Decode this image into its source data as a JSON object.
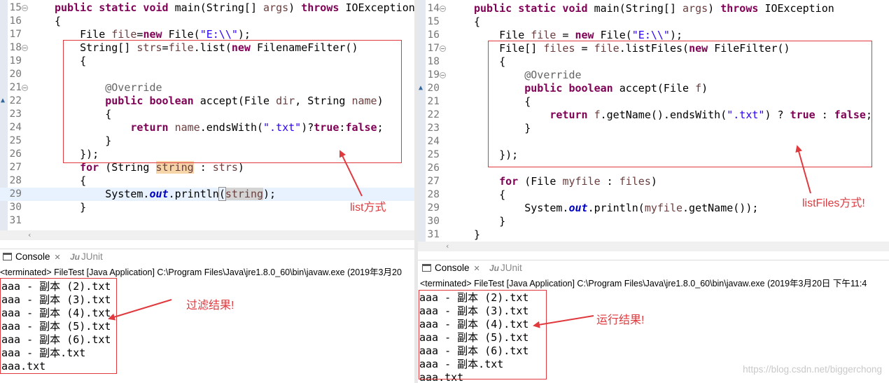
{
  "left": {
    "code": [
      {
        "n": "15",
        "fold": true,
        "t": [
          [
            "kw",
            "public static void "
          ],
          [
            "",
            "main(String[] "
          ],
          [
            "vr",
            "args"
          ],
          [
            "",
            ") "
          ],
          [
            "kw",
            "throws "
          ],
          [
            "",
            "IOException"
          ]
        ]
      },
      {
        "n": "16",
        "t": [
          [
            "",
            "{"
          ]
        ]
      },
      {
        "n": "17",
        "t": [
          [
            "",
            "    File "
          ],
          [
            "vr",
            "file"
          ],
          [
            "",
            "="
          ],
          [
            "kw",
            "new "
          ],
          [
            "",
            "File("
          ],
          [
            "st",
            "\"E:\\\\\""
          ],
          [
            "",
            ");"
          ]
        ]
      },
      {
        "n": "18",
        "fold": true,
        "t": [
          [
            "",
            "    String[] "
          ],
          [
            "vr",
            "strs"
          ],
          [
            "",
            "="
          ],
          [
            "vr",
            "file"
          ],
          [
            "",
            ".list("
          ],
          [
            "kw",
            "new "
          ],
          [
            "",
            "FilenameFilter()"
          ]
        ]
      },
      {
        "n": "19",
        "t": [
          [
            "",
            "    {"
          ]
        ]
      },
      {
        "n": "20",
        "t": []
      },
      {
        "n": "21",
        "fold": true,
        "t": [
          [
            "an",
            "        @Override"
          ]
        ]
      },
      {
        "n": "22",
        "ovr": true,
        "t": [
          [
            "kw",
            "        public boolean "
          ],
          [
            "",
            "accept(File "
          ],
          [
            "vr",
            "dir"
          ],
          [
            "",
            ", String "
          ],
          [
            "vr",
            "name"
          ],
          [
            "",
            ")"
          ]
        ]
      },
      {
        "n": "23",
        "t": [
          [
            "",
            "        {"
          ]
        ]
      },
      {
        "n": "24",
        "t": [
          [
            "kw",
            "            return "
          ],
          [
            "vr",
            "name"
          ],
          [
            "",
            ".endsWith("
          ],
          [
            "st",
            "\".txt\""
          ],
          [
            "",
            ")?"
          ],
          [
            "kw",
            "true"
          ],
          [
            "",
            ":"
          ],
          [
            "kw",
            "false"
          ],
          [
            "",
            ";"
          ]
        ]
      },
      {
        "n": "25",
        "t": [
          [
            "",
            "        }"
          ]
        ]
      },
      {
        "n": "26",
        "t": [
          [
            "",
            "    });"
          ]
        ]
      },
      {
        "n": "27",
        "t": [
          [
            "kw",
            "    for "
          ],
          [
            "",
            "(String "
          ],
          [
            "vr hl",
            "string"
          ],
          [
            "",
            " : "
          ],
          [
            "vr",
            "strs"
          ],
          [
            "",
            ")"
          ]
        ]
      },
      {
        "n": "28",
        "t": [
          [
            "",
            "    {"
          ]
        ]
      },
      {
        "n": "29",
        "cur": true,
        "t": [
          [
            "",
            "        System."
          ],
          [
            "fi",
            "out"
          ],
          [
            "",
            ".println"
          ],
          [
            "hl3",
            "("
          ],
          [
            "vr hl2",
            "string"
          ],
          [
            "",
            ");"
          ]
        ]
      },
      {
        "n": "30",
        "t": [
          [
            "",
            "    }"
          ]
        ]
      },
      {
        "n": "31",
        "t": []
      }
    ],
    "console_tab": "Console",
    "junit_tab": "JUnit",
    "terminated": "<terminated> FileTest [Java Application] C:\\Program Files\\Java\\jre1.8.0_60\\bin\\javaw.exe (2019年3月20",
    "output": [
      "aaa - 副本 (2).txt",
      "aaa - 副本 (3).txt",
      "aaa - 副本 (4).txt",
      "aaa - 副本 (5).txt",
      "aaa - 副本 (6).txt",
      "aaa - 副本.txt",
      "aaa.txt"
    ],
    "note_code": "list方式",
    "note_output": "过滤结果!"
  },
  "right": {
    "code": [
      {
        "n": "14",
        "fold": true,
        "t": [
          [
            "kw",
            "public static void "
          ],
          [
            "",
            "main(String[] "
          ],
          [
            "vr",
            "args"
          ],
          [
            "",
            ") "
          ],
          [
            "kw",
            "throws "
          ],
          [
            "",
            "IOException"
          ]
        ]
      },
      {
        "n": "15",
        "t": [
          [
            "",
            "{"
          ]
        ]
      },
      {
        "n": "16",
        "t": [
          [
            "",
            "    File "
          ],
          [
            "vr",
            "file"
          ],
          [
            "",
            " = "
          ],
          [
            "kw",
            "new "
          ],
          [
            "",
            "File("
          ],
          [
            "st",
            "\"E:\\\\\""
          ],
          [
            "",
            ");"
          ]
        ]
      },
      {
        "n": "17",
        "fold": true,
        "t": [
          [
            "",
            "    File[] "
          ],
          [
            "vr",
            "files"
          ],
          [
            "",
            " = "
          ],
          [
            "vr",
            "file"
          ],
          [
            "",
            ".listFiles("
          ],
          [
            "kw",
            "new "
          ],
          [
            "",
            "FileFilter()"
          ]
        ]
      },
      {
        "n": "18",
        "t": [
          [
            "",
            "    {"
          ]
        ]
      },
      {
        "n": "19",
        "fold": true,
        "t": [
          [
            "an",
            "        @Override"
          ]
        ]
      },
      {
        "n": "20",
        "ovr": true,
        "t": [
          [
            "kw",
            "        public boolean "
          ],
          [
            "",
            "accept(File "
          ],
          [
            "vr",
            "f"
          ],
          [
            "",
            ")"
          ]
        ]
      },
      {
        "n": "21",
        "t": [
          [
            "",
            "        {"
          ]
        ]
      },
      {
        "n": "22",
        "t": [
          [
            "kw",
            "            return "
          ],
          [
            "vr",
            "f"
          ],
          [
            "",
            ".getName().endsWith("
          ],
          [
            "st",
            "\".txt\""
          ],
          [
            "",
            ") ? "
          ],
          [
            "kw",
            "true"
          ],
          [
            "",
            " : "
          ],
          [
            "kw",
            "false"
          ],
          [
            "",
            ";"
          ]
        ]
      },
      {
        "n": "23",
        "t": [
          [
            "",
            "        }"
          ]
        ]
      },
      {
        "n": "24",
        "t": []
      },
      {
        "n": "25",
        "t": [
          [
            "",
            "    });"
          ]
        ]
      },
      {
        "n": "26",
        "t": []
      },
      {
        "n": "27",
        "t": [
          [
            "kw",
            "    for "
          ],
          [
            "",
            "(File "
          ],
          [
            "vr",
            "myfile"
          ],
          [
            "",
            " : "
          ],
          [
            "vr",
            "files"
          ],
          [
            "",
            ")"
          ]
        ]
      },
      {
        "n": "28",
        "t": [
          [
            "",
            "    {"
          ]
        ]
      },
      {
        "n": "29",
        "t": [
          [
            "",
            "        System."
          ],
          [
            "fi",
            "out"
          ],
          [
            "",
            ".println("
          ],
          [
            "vr",
            "myfile"
          ],
          [
            "",
            ".getName());"
          ]
        ]
      },
      {
        "n": "30",
        "t": [
          [
            "",
            "    }"
          ]
        ]
      },
      {
        "n": "31",
        "t": [
          [
            "",
            "}"
          ]
        ]
      }
    ],
    "console_tab": "Console",
    "junit_tab": "JUnit",
    "terminated": "<terminated> FileTest [Java Application] C:\\Program Files\\Java\\jre1.8.0_60\\bin\\javaw.exe (2019年3月20日 下午11:4",
    "output": [
      "aaa - 副本 (2).txt",
      "aaa - 副本 (3).txt",
      "aaa - 副本 (4).txt",
      "aaa - 副本 (5).txt",
      "aaa - 副本 (6).txt",
      "aaa - 副本.txt",
      "aaa.txt"
    ],
    "note_code": "listFiles方式!",
    "note_output": "运行结果!"
  },
  "watermark": "https://blog.csdn.net/biggerchong",
  "colors": {
    "annotation": "#e0393e",
    "keyword": "#7f0055",
    "string": "#2a00ff",
    "variable": "#6a3e3e"
  }
}
